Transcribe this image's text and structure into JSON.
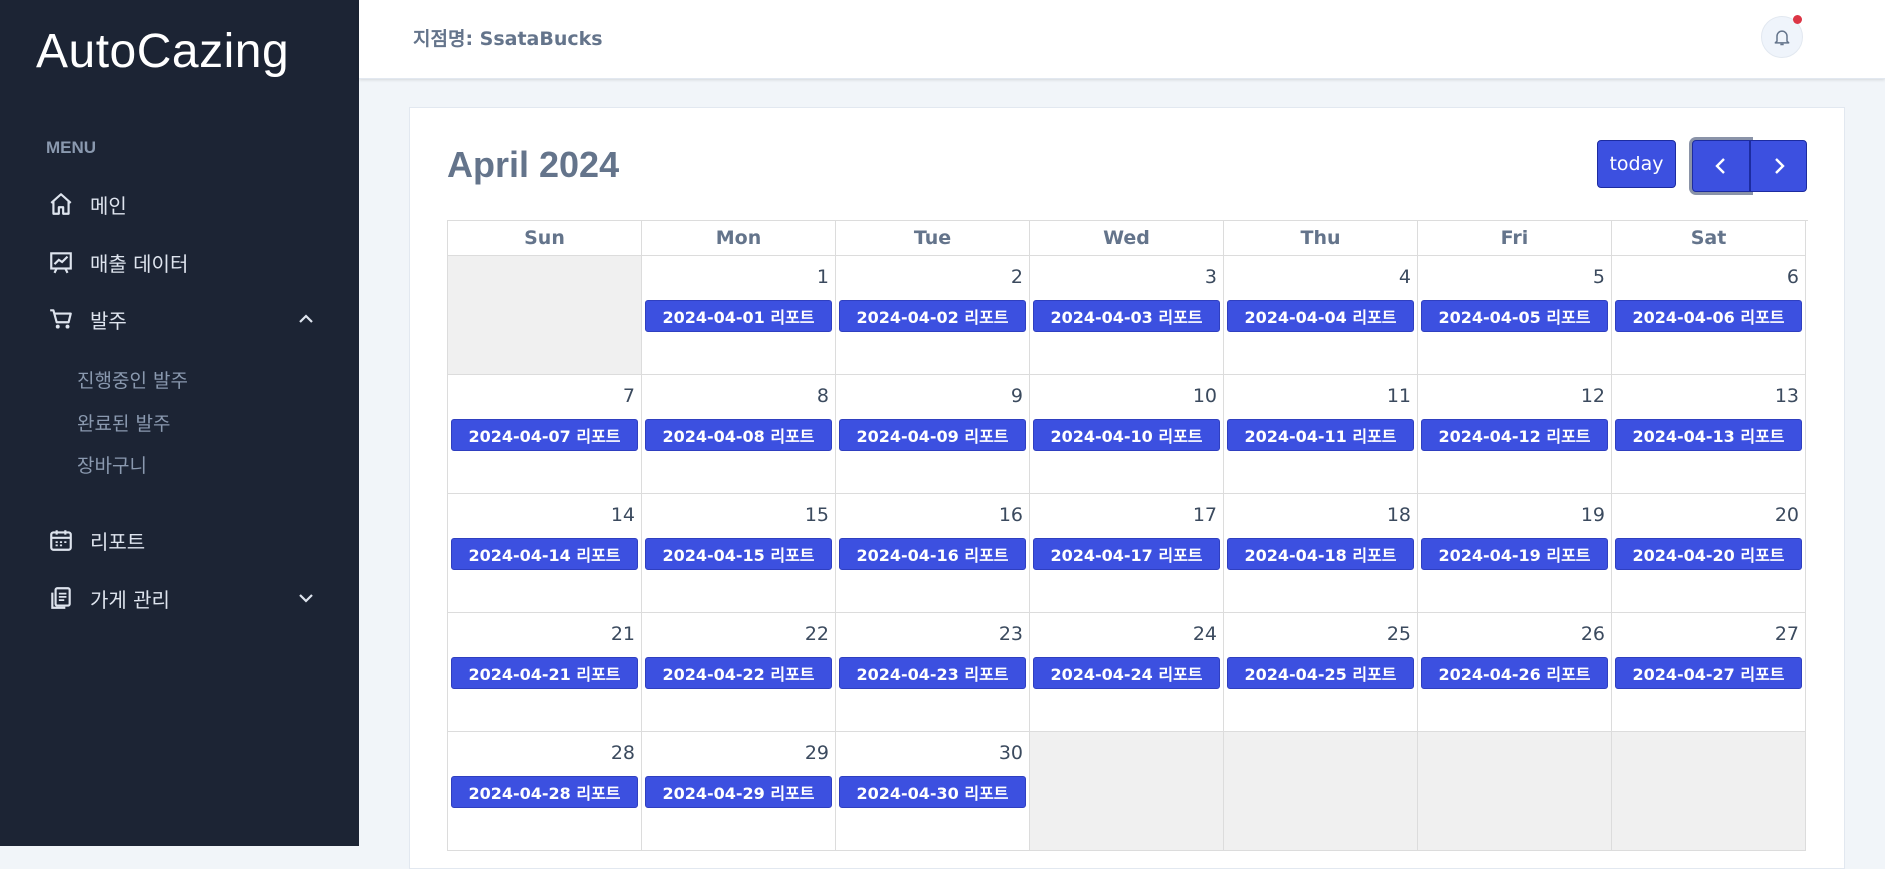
{
  "brand": "AutoCazing",
  "sidebar": {
    "menu_heading": "MENU",
    "items": [
      {
        "label": "메인"
      },
      {
        "label": "매출 데이터"
      },
      {
        "label": "발주"
      },
      {
        "label": "리포트"
      },
      {
        "label": "가게 관리"
      }
    ],
    "order_sub_items": [
      "진행중인 발주",
      "완료된 발주",
      "장바구니"
    ]
  },
  "header": {
    "store_label": "지점명: SsataBucks"
  },
  "calendar": {
    "title": "April 2024",
    "today_label": "today",
    "days_of_week": [
      "Sun",
      "Mon",
      "Tue",
      "Wed",
      "Thu",
      "Fri",
      "Sat"
    ],
    "weeks": [
      [
        null,
        {
          "day": "1",
          "event": "2024-04-01 리포트"
        },
        {
          "day": "2",
          "event": "2024-04-02 리포트"
        },
        {
          "day": "3",
          "event": "2024-04-03 리포트"
        },
        {
          "day": "4",
          "event": "2024-04-04 리포트"
        },
        {
          "day": "5",
          "event": "2024-04-05 리포트"
        },
        {
          "day": "6",
          "event": "2024-04-06 리포트"
        }
      ],
      [
        {
          "day": "7",
          "event": "2024-04-07 리포트"
        },
        {
          "day": "8",
          "event": "2024-04-08 리포트"
        },
        {
          "day": "9",
          "event": "2024-04-09 리포트"
        },
        {
          "day": "10",
          "event": "2024-04-10 리포트"
        },
        {
          "day": "11",
          "event": "2024-04-11 리포트"
        },
        {
          "day": "12",
          "event": "2024-04-12 리포트"
        },
        {
          "day": "13",
          "event": "2024-04-13 리포트"
        }
      ],
      [
        {
          "day": "14",
          "event": "2024-04-14 리포트"
        },
        {
          "day": "15",
          "event": "2024-04-15 리포트"
        },
        {
          "day": "16",
          "event": "2024-04-16 리포트"
        },
        {
          "day": "17",
          "event": "2024-04-17 리포트"
        },
        {
          "day": "18",
          "event": "2024-04-18 리포트"
        },
        {
          "day": "19",
          "event": "2024-04-19 리포트"
        },
        {
          "day": "20",
          "event": "2024-04-20 리포트"
        }
      ],
      [
        {
          "day": "21",
          "event": "2024-04-21 리포트"
        },
        {
          "day": "22",
          "event": "2024-04-22 리포트"
        },
        {
          "day": "23",
          "event": "2024-04-23 리포트"
        },
        {
          "day": "24",
          "event": "2024-04-24 리포트"
        },
        {
          "day": "25",
          "event": "2024-04-25 리포트"
        },
        {
          "day": "26",
          "event": "2024-04-26 리포트"
        },
        {
          "day": "27",
          "event": "2024-04-27 리포트"
        }
      ],
      [
        {
          "day": "28",
          "event": "2024-04-28 리포트"
        },
        {
          "day": "29",
          "event": "2024-04-29 리포트"
        },
        {
          "day": "30",
          "event": "2024-04-30 리포트"
        },
        null,
        null,
        null,
        null
      ]
    ]
  },
  "colors": {
    "sidebar_bg": "#1c2434",
    "accent": "#3c50e0",
    "notification_dot": "#dc3545"
  }
}
